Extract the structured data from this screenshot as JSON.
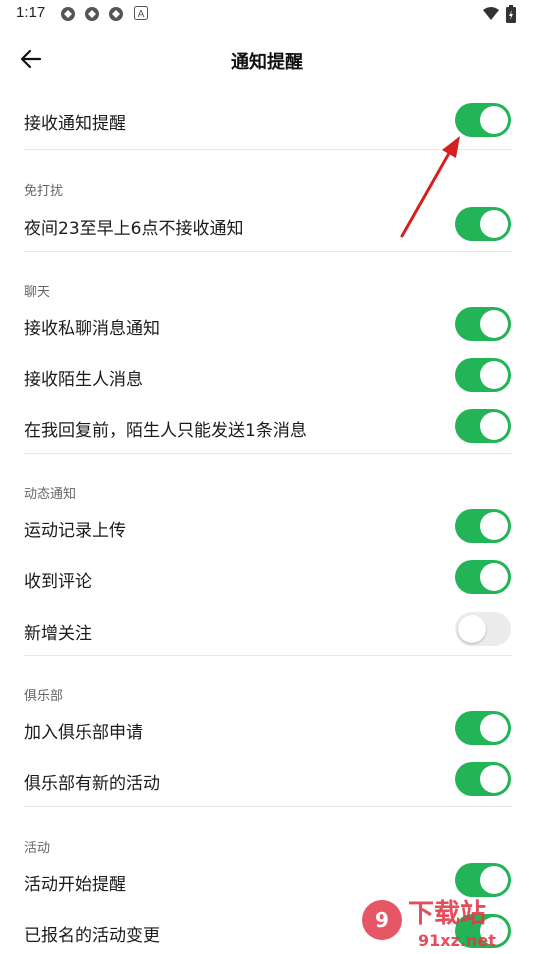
{
  "status_bar": {
    "time": "1:17",
    "notification_icons": [
      "app-icon",
      "app-icon",
      "app-icon",
      "a-icon"
    ],
    "right_icons": [
      "wifi-icon",
      "battery-icon"
    ]
  },
  "header": {
    "title": "通知提醒",
    "back_icon": "back-arrow-icon"
  },
  "colors": {
    "toggle_on": "#22b456",
    "toggle_off": "#ececec",
    "annotation_arrow": "#d42020"
  },
  "main_toggle": {
    "label": "接收通知提醒",
    "on": true
  },
  "sections": [
    {
      "title": "免打扰",
      "items": [
        {
          "label": "夜间23至早上6点不接收通知",
          "on": true
        }
      ]
    },
    {
      "title": "聊天",
      "items": [
        {
          "label": "接收私聊消息通知",
          "on": true
        },
        {
          "label": "接收陌生人消息",
          "on": true
        },
        {
          "label": "在我回复前，陌生人只能发送1条消息",
          "on": true
        }
      ]
    },
    {
      "title": "动态通知",
      "items": [
        {
          "label": "运动记录上传",
          "on": true
        },
        {
          "label": "收到评论",
          "on": true
        },
        {
          "label": "新增关注",
          "on": false
        }
      ]
    },
    {
      "title": "俱乐部",
      "items": [
        {
          "label": "加入俱乐部申请",
          "on": true
        },
        {
          "label": "俱乐部有新的活动",
          "on": true
        }
      ]
    },
    {
      "title": "活动",
      "items": [
        {
          "label": "活动开始提醒",
          "on": true
        },
        {
          "label": "已报名的活动变更",
          "on": true
        }
      ]
    }
  ],
  "watermark": {
    "text": "下载站",
    "domain": "91xz.net"
  }
}
